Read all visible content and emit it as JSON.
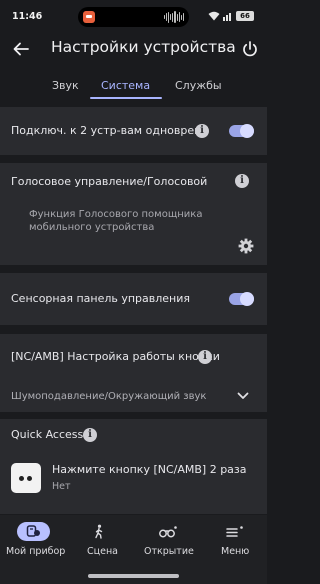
{
  "status_bar": {
    "time": "11:46",
    "battery": "66"
  },
  "header": {
    "title": "Настройки устройства"
  },
  "tabs": [
    {
      "label": "Звук",
      "active": false
    },
    {
      "label": "Система",
      "active": true
    },
    {
      "label": "Службы",
      "active": false
    }
  ],
  "settings": {
    "multipoint": {
      "label": "Подключ. к 2 устр-вам одноврем.",
      "enabled": true
    },
    "voice": {
      "title": "Голосовое управление/Голосовой",
      "description": "Функция Голосового помощника мобильного устройства"
    },
    "touchpad": {
      "label": "Сенсорная панель управления",
      "enabled": true
    },
    "nc_amb": {
      "title": "[NC/AMB] Настройка работы кнопки",
      "selected_value": "Шумоподавление/Окружающий звук"
    },
    "quick_access": {
      "title": "Quick Access",
      "item_title": "Нажмите кнопку [NC/AMB] 2 раза",
      "item_value": "Нет"
    }
  },
  "bottom_nav": [
    {
      "label": "Мой прибор",
      "icon": "device-icon",
      "active": true
    },
    {
      "label": "Сцена",
      "icon": "walking-person-icon",
      "active": false
    },
    {
      "label": "Открытие",
      "icon": "binoculars-icon",
      "active": false
    },
    {
      "label": "Меню",
      "icon": "menu-icon",
      "active": false
    }
  ],
  "colors": {
    "accent": "#a9b5ff",
    "background": "#1a1b1e",
    "card": "#2a2b2f"
  }
}
